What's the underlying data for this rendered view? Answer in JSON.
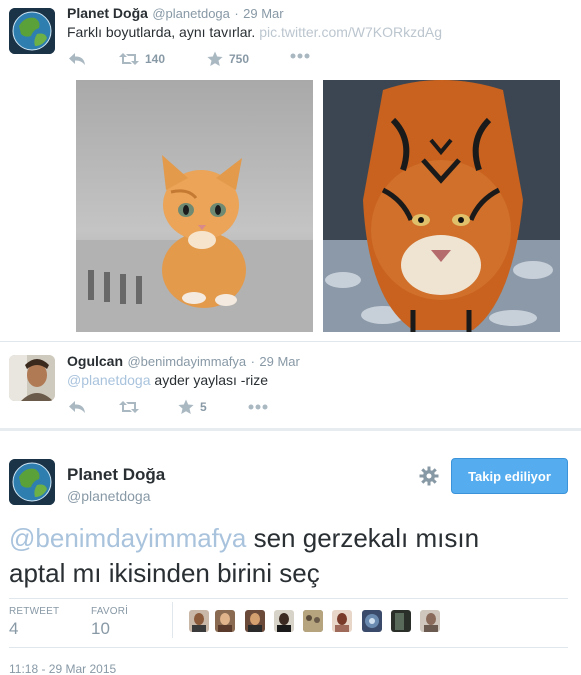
{
  "tweet1": {
    "name": "Planet Doğa",
    "handle": "@planetdoga",
    "separator": "·",
    "date": "29 Mar",
    "text": "Farklı boyutlarda, aynı tavırlar.",
    "link": "pic.twitter.com/W7KORkzdAg",
    "retweet_count": "140",
    "favorite_count": "750",
    "images": [
      {
        "subject": "kitten"
      },
      {
        "subject": "tiger"
      }
    ]
  },
  "tweet2": {
    "name": "Ogulcan",
    "handle": "@benimdayimmafya",
    "separator": "·",
    "date": "29 Mar",
    "mention": "@planetdoga",
    "text": " ayder yaylası -rize",
    "favorite_count": "5"
  },
  "main": {
    "name": "Planet Doğa",
    "handle": "@planetdoga",
    "follow_label": "Takip ediliyor",
    "mention": "@benimdayimmafya",
    "text_line1": " sen gerzekalı mısın",
    "text_line2": "aptal mı ikisinden birini seç",
    "retweet_label": "RETWEET",
    "retweet_value": "4",
    "favorite_label": "FAVORİ",
    "favorite_value": "10",
    "timestamp": "11:18 - 29 Mar 2015"
  },
  "colors": {
    "accent": "#55acee",
    "muted": "#8899a6",
    "link_faded": "#bcc6cf"
  },
  "icons": [
    "reply-icon",
    "retweet-icon",
    "favorite-icon",
    "more-icon",
    "gear-icon"
  ]
}
